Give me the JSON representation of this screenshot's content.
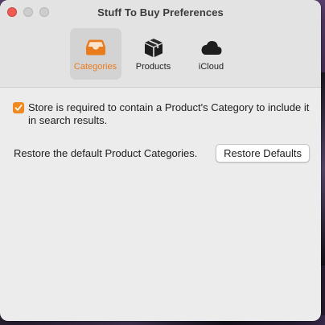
{
  "window": {
    "title": "Stuff To Buy Preferences"
  },
  "toolbar": {
    "items": [
      {
        "label": "Categories",
        "icon": "tray-icon",
        "selected": true
      },
      {
        "label": "Products",
        "icon": "box-icon",
        "selected": false
      },
      {
        "label": "iCloud",
        "icon": "cloud-icon",
        "selected": false
      }
    ]
  },
  "settings": {
    "store_requires_category": {
      "label": "Store is required to contain a Product's Category to include it in search results.",
      "checked": true
    },
    "restore": {
      "description": "Restore the default Product Categories.",
      "button_label": "Restore Defaults"
    }
  },
  "colors": {
    "accent": "#ea7b1d",
    "checkbox": "#f0891f",
    "close_button": "#ee5b55"
  }
}
